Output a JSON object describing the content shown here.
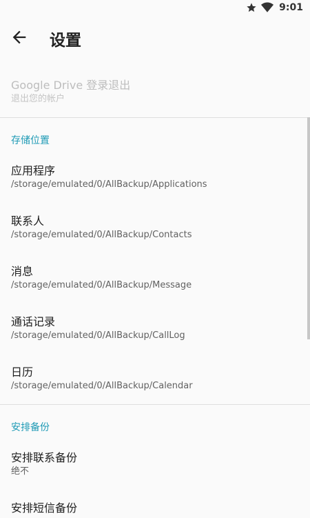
{
  "status_bar": {
    "time": "9:01",
    "icons": [
      "star-icon",
      "wifi-icon"
    ]
  },
  "toolbar": {
    "title": "设置",
    "back_icon": "arrow-back-icon"
  },
  "account": {
    "title": "Google Drive 登录退出",
    "summary": "退出您的帐户"
  },
  "storage": {
    "header": "存储位置",
    "items": [
      {
        "title": "应用程序",
        "summary": "/storage/emulated/0/AllBackup/Applications"
      },
      {
        "title": "联系人",
        "summary": "/storage/emulated/0/AllBackup/Contacts"
      },
      {
        "title": "消息",
        "summary": "/storage/emulated/0/AllBackup/Message"
      },
      {
        "title": "通话记录",
        "summary": "/storage/emulated/0/AllBackup/CallLog"
      },
      {
        "title": "日历",
        "summary": "/storage/emulated/0/AllBackup/Calendar"
      }
    ]
  },
  "schedule": {
    "header": "安排备份",
    "items": [
      {
        "title": "安排联系备份",
        "summary": "绝不"
      },
      {
        "title": "安排短信备份",
        "summary": ""
      }
    ]
  },
  "colors": {
    "accent": "#1e9ab5",
    "background": "#fafafa",
    "divider": "#dedede"
  }
}
